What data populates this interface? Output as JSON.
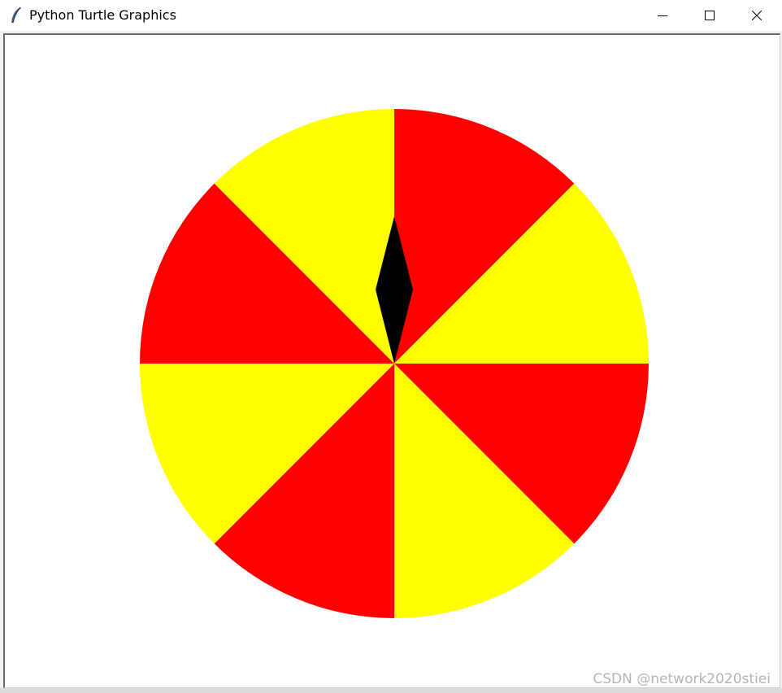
{
  "window": {
    "title": "Python Turtle Graphics",
    "icon": "feather-icon"
  },
  "controls": {
    "minimize": "minimize-icon",
    "maximize": "maximize-icon",
    "close": "close-icon"
  },
  "canvas": {
    "background": "#ffffff",
    "wheel": {
      "sector_count": 8,
      "colors": [
        "#ff0000",
        "#ffff00"
      ],
      "pointer_color": "#000000",
      "pointer_angle_deg": 0
    }
  },
  "watermark": "CSDN @network2020stiei"
}
